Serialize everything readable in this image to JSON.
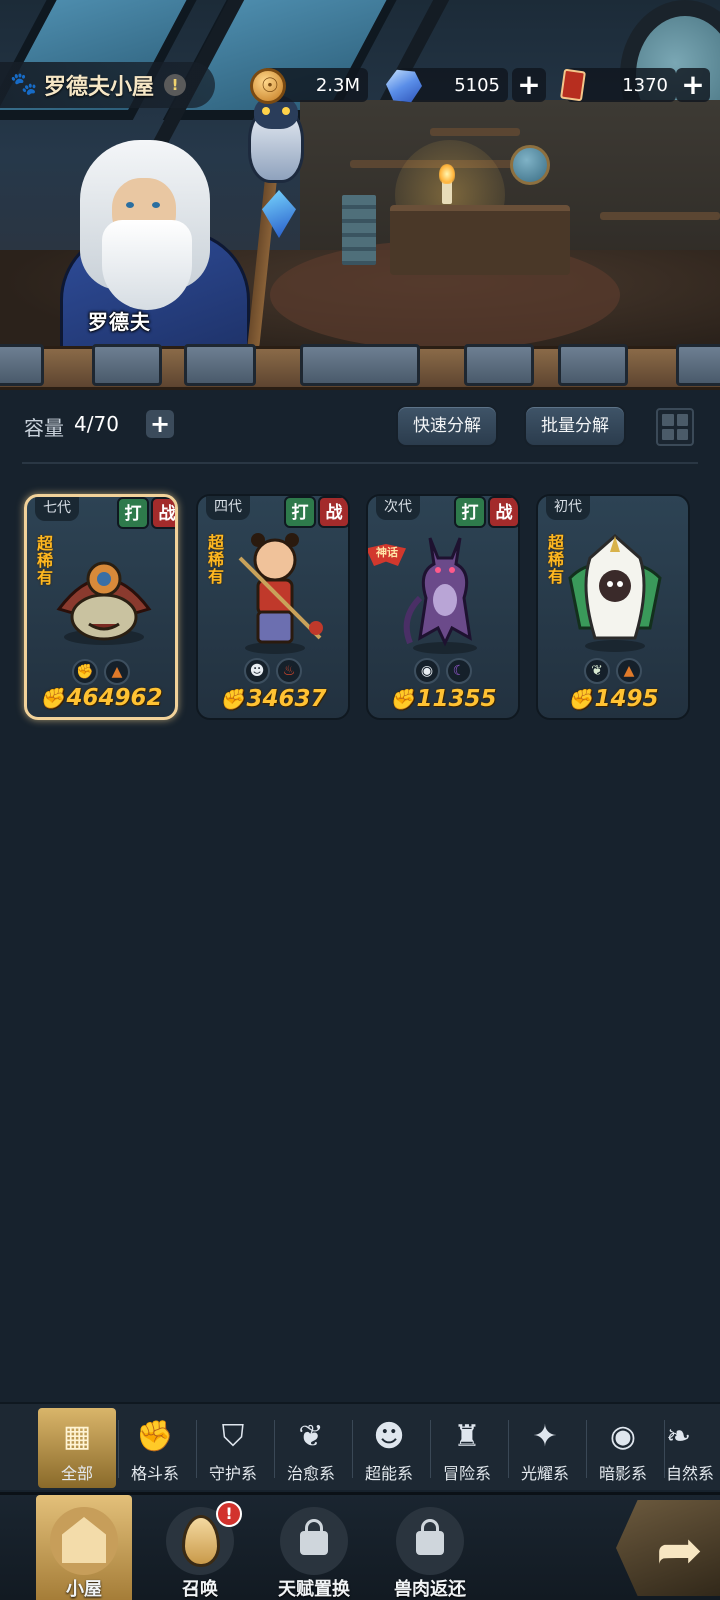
{
  "header": {
    "title": "罗德夫小屋",
    "info_icon": "!",
    "paw_icon": "paw-icon"
  },
  "resources": {
    "gold": "2.3M",
    "gems": "5105",
    "tickets": "1370",
    "plus": "+"
  },
  "scene": {
    "npc_name": "罗德夫"
  },
  "inventory": {
    "capacity_label": "容量",
    "capacity_value": "4/70",
    "add_label": "+",
    "quick_decompose": "快速分解",
    "batch_decompose": "批量分解"
  },
  "cards": [
    {
      "generation": "七代",
      "tags": [
        "打",
        "战"
      ],
      "rarity": "超稀有",
      "power": "464962",
      "elements": [
        "fist-icon",
        "rock-icon"
      ],
      "selected": true
    },
    {
      "generation": "四代",
      "tags": [
        "打",
        "战"
      ],
      "rarity": "超稀有",
      "power": "34637",
      "elements": [
        "alien-icon",
        "fire-icon"
      ],
      "selected": false
    },
    {
      "generation": "次代",
      "tags": [
        "打",
        "战"
      ],
      "rarity": "",
      "badge": "神话",
      "power": "11355",
      "elements": [
        "shadow-eye-icon",
        "moon-icon"
      ],
      "selected": false
    },
    {
      "generation": "初代",
      "tags": [],
      "rarity": "超稀有",
      "power": "1495",
      "elements": [
        "sprout-icon",
        "rock-icon"
      ],
      "selected": false
    }
  ],
  "filters": [
    {
      "label": "全部",
      "icon": "all-blocks-icon",
      "active": true
    },
    {
      "label": "格斗系",
      "icon": "fist-icon"
    },
    {
      "label": "守护系",
      "icon": "shield-icon"
    },
    {
      "label": "治愈系",
      "icon": "sprout-icon"
    },
    {
      "label": "超能系",
      "icon": "alien-icon"
    },
    {
      "label": "冒险系",
      "icon": "lantern-icon"
    },
    {
      "label": "光耀系",
      "icon": "star-icon"
    },
    {
      "label": "暗影系",
      "icon": "shadow-eye-icon"
    },
    {
      "label": "自然系",
      "icon": "leaf-icon"
    }
  ],
  "nav": [
    {
      "label": "小屋",
      "icon": "house-icon",
      "active": true
    },
    {
      "label": "召唤",
      "icon": "egg-icon",
      "alert": "!"
    },
    {
      "label": "天赋置换",
      "icon": "lock-icon"
    },
    {
      "label": "兽肉返还",
      "icon": "lock-icon"
    }
  ],
  "colors": {
    "accent_gold": "#ffc233",
    "bg": "#17222d",
    "tag_hit": "#2e7a4b",
    "tag_fight": "#a32b2b"
  }
}
